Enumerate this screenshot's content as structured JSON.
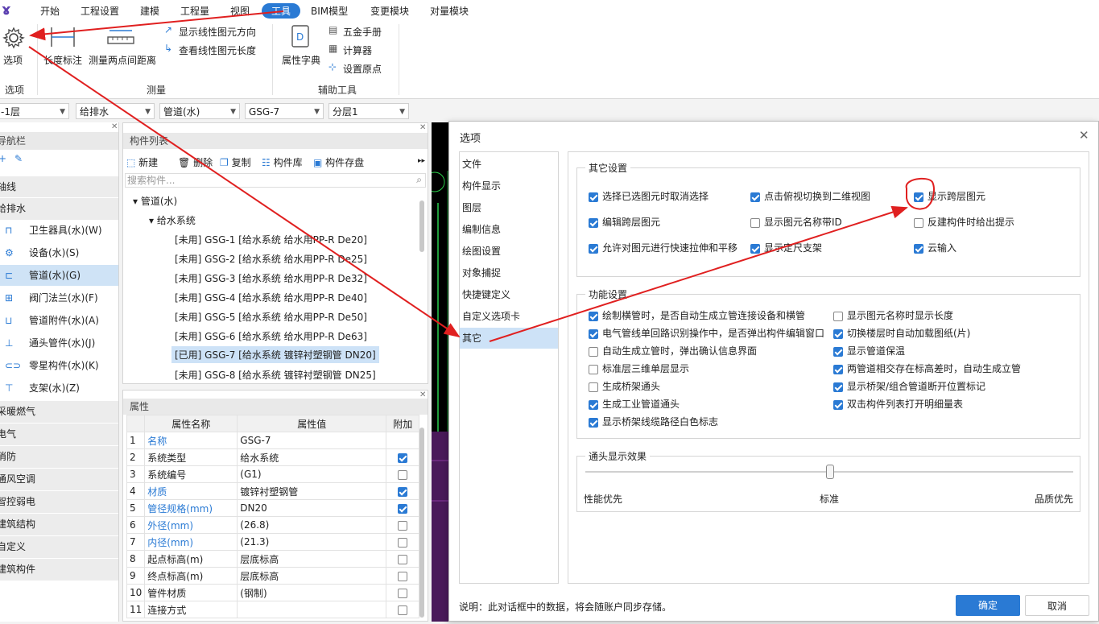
{
  "menu": {
    "items": [
      "开始",
      "工程设置",
      "建模",
      "工程量",
      "视图",
      "工具",
      "BIM模型",
      "变更模块",
      "对量模块"
    ],
    "active": "工具"
  },
  "ribbon": {
    "options_label": "选项",
    "length_label": "长度标注",
    "measure_label": "测量两点间距离",
    "show_dir": "显示线性图元方向",
    "view_len": "查看线性图元长度",
    "prop_dict": "属性字典",
    "hardware": "五金手册",
    "calculator": "计算器",
    "set_origin": "设置原点",
    "group_options": "选项",
    "group_measure": "测量",
    "group_aux": "辅助工具"
  },
  "filters": [
    "-1层",
    "给排水",
    "管道(水)",
    "GSG-7",
    "分层1"
  ],
  "nav": {
    "title": "导航栏",
    "axis": "轴线",
    "section_water": "给排水",
    "items": [
      "卫生器具(水)(W)",
      "设备(水)(S)",
      "管道(水)(G)",
      "阀门法兰(水)(F)",
      "管道附件(水)(A)",
      "通头管件(水)(J)",
      "零星构件(水)(K)",
      "支架(水)(Z)"
    ],
    "sections": [
      "采暖燃气",
      "电气",
      "消防",
      "通风空调",
      "智控弱电",
      "建筑结构",
      "自定义",
      "建筑构件"
    ]
  },
  "complist": {
    "title": "构件列表",
    "new": "新建",
    "delete": "删除",
    "copy": "复制",
    "library": "构件库",
    "storage": "构件存盘",
    "search_placeholder": "搜索构件...",
    "root": "管道(水)",
    "system": "给水系统",
    "rows": [
      "[未用] GSG-1 [给水系统 给水用PP-R De20]",
      "[未用] GSG-2 [给水系统 给水用PP-R De25]",
      "[未用] GSG-3 [给水系统 给水用PP-R De32]",
      "[未用] GSG-4 [给水系统 给水用PP-R De40]",
      "[未用] GSG-5 [给水系统 给水用PP-R De50]",
      "[未用] GSG-6 [给水系统 给水用PP-R De63]",
      "[已用] GSG-7 [给水系统 镀锌衬塑钢管 DN20]",
      "[未用] GSG-8 [给水系统 镀锌衬塑钢管 DN25]"
    ]
  },
  "props": {
    "title": "属性",
    "col_name": "属性名称",
    "col_value": "属性值",
    "col_extra": "附加",
    "rows": [
      {
        "no": "1",
        "name": "名称",
        "value": "GSG-7",
        "blue": true,
        "check": null
      },
      {
        "no": "2",
        "name": "系统类型",
        "value": "给水系统",
        "blue": false,
        "check": true
      },
      {
        "no": "3",
        "name": "系统编号",
        "value": "(G1)",
        "blue": false,
        "check": false
      },
      {
        "no": "4",
        "name": "材质",
        "value": "镀锌衬塑钢管",
        "blue": true,
        "check": true
      },
      {
        "no": "5",
        "name": "管径规格(mm)",
        "value": "DN20",
        "blue": true,
        "check": true
      },
      {
        "no": "6",
        "name": "外径(mm)",
        "value": "(26.8)",
        "blue": true,
        "check": false
      },
      {
        "no": "7",
        "name": "内径(mm)",
        "value": "(21.3)",
        "blue": true,
        "check": false
      },
      {
        "no": "8",
        "name": "起点标高(m)",
        "value": "层底标高",
        "blue": false,
        "check": false
      },
      {
        "no": "9",
        "name": "终点标高(m)",
        "value": "层底标高",
        "blue": false,
        "check": false
      },
      {
        "no": "10",
        "name": "管件材质",
        "value": "(钢制)",
        "blue": false,
        "check": false
      },
      {
        "no": "11",
        "name": "连接方式",
        "value": "",
        "blue": false,
        "check": false
      }
    ]
  },
  "dialog": {
    "title": "选项",
    "nav": [
      "文件",
      "构件显示",
      "图层",
      "编制信息",
      "绘图设置",
      "对象捕捉",
      "快捷键定义",
      "自定义选项卡",
      "其它"
    ],
    "selected_nav": "其它",
    "other_title": "其它设置",
    "other": [
      {
        "label": "选择已选图元时取消选择",
        "checked": true
      },
      {
        "label": "点击俯视切换到二维视图",
        "checked": true
      },
      {
        "label": "显示跨层图元",
        "checked": true
      },
      {
        "label": "编辑跨层图元",
        "checked": true
      },
      {
        "label": "显示图元名称带ID",
        "checked": false
      },
      {
        "label": "反建构件时给出提示",
        "checked": false
      },
      {
        "label": "允许对图元进行快速拉伸和平移",
        "checked": true
      },
      {
        "label": "显示定尺支架",
        "checked": true
      },
      {
        "label": "云输入",
        "checked": true
      }
    ],
    "func_title": "功能设置",
    "func_left": [
      {
        "label": "绘制横管时，是否自动生成立管连接设备和横管",
        "checked": true
      },
      {
        "label": "电气管线单回路识别操作中，是否弹出构件编辑窗口",
        "checked": true
      },
      {
        "label": "自动生成立管时，弹出确认信息界面",
        "checked": false
      },
      {
        "label": "标准层三维单层显示",
        "checked": false
      },
      {
        "label": "生成桥架通头",
        "checked": false
      },
      {
        "label": "生成工业管道通头",
        "checked": true
      },
      {
        "label": "显示桥架线缆路径白色标志",
        "checked": true
      }
    ],
    "func_right": [
      {
        "label": "显示图元名称时显示长度",
        "checked": false
      },
      {
        "label": "切换楼层时自动加载图纸(片)",
        "checked": true
      },
      {
        "label": "显示管道保温",
        "checked": true
      },
      {
        "label": "两管道相交存在标高差时，自动生成立管",
        "checked": true
      },
      {
        "label": "显示桥架/组合管道断开位置标记",
        "checked": true
      },
      {
        "label": "双击构件列表打开明细量表",
        "checked": true
      }
    ],
    "slider_title": "通头显示效果",
    "slider_labels": [
      "性能优先",
      "标准",
      "品质优先"
    ],
    "slider_value": 0.5,
    "note": "说明：此对话框中的数据，将会随账户同步存储。",
    "ok": "确定",
    "cancel": "取消"
  },
  "colors": {
    "accent": "#2a7ad4",
    "arrow": "#e02020",
    "selected": "#cde2f7"
  }
}
